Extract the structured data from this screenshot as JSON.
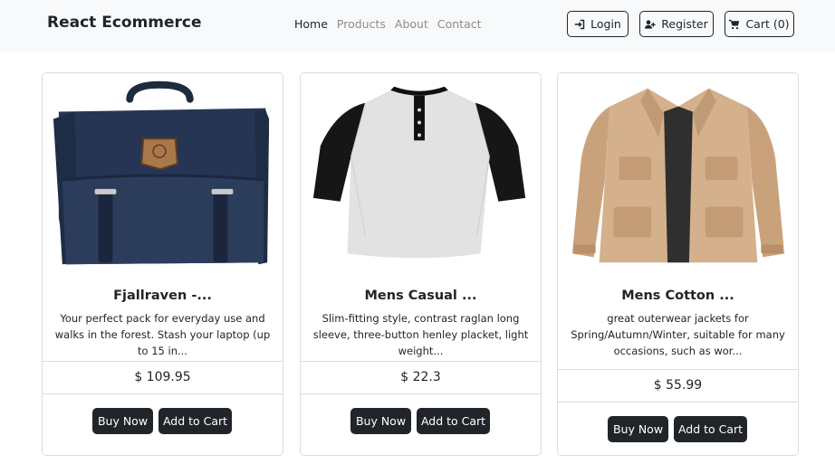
{
  "navbar": {
    "brand": "React Ecommerce",
    "links": [
      "Home",
      "Products",
      "About",
      "Contact"
    ],
    "login_label": "Login",
    "register_label": "Register",
    "cart_label": "Cart (0)"
  },
  "products": [
    {
      "title": "Fjallraven -...",
      "description": "Your perfect pack for everyday use and walks in the forest. Stash your laptop (up to 15 in...",
      "price": "$ 109.95",
      "buy_label": "Buy Now",
      "cart_label": "Add to Cart",
      "image": "navy-backpack"
    },
    {
      "title": "Mens Casual ...",
      "description": "Slim-fitting style, contrast raglan long sleeve, three-button henley placket, light weight...",
      "price": "$ 22.3",
      "buy_label": "Buy Now",
      "cart_label": "Add to Cart",
      "image": "raglan-henley-shirt"
    },
    {
      "title": "Mens Cotton ...",
      "description": "great outerwear jackets for Spring/Autumn/Winter, suitable for many occasions, such as wor...",
      "price": "$ 55.99",
      "buy_label": "Buy Now",
      "cart_label": "Add to Cart",
      "image": "khaki-jacket"
    }
  ]
}
